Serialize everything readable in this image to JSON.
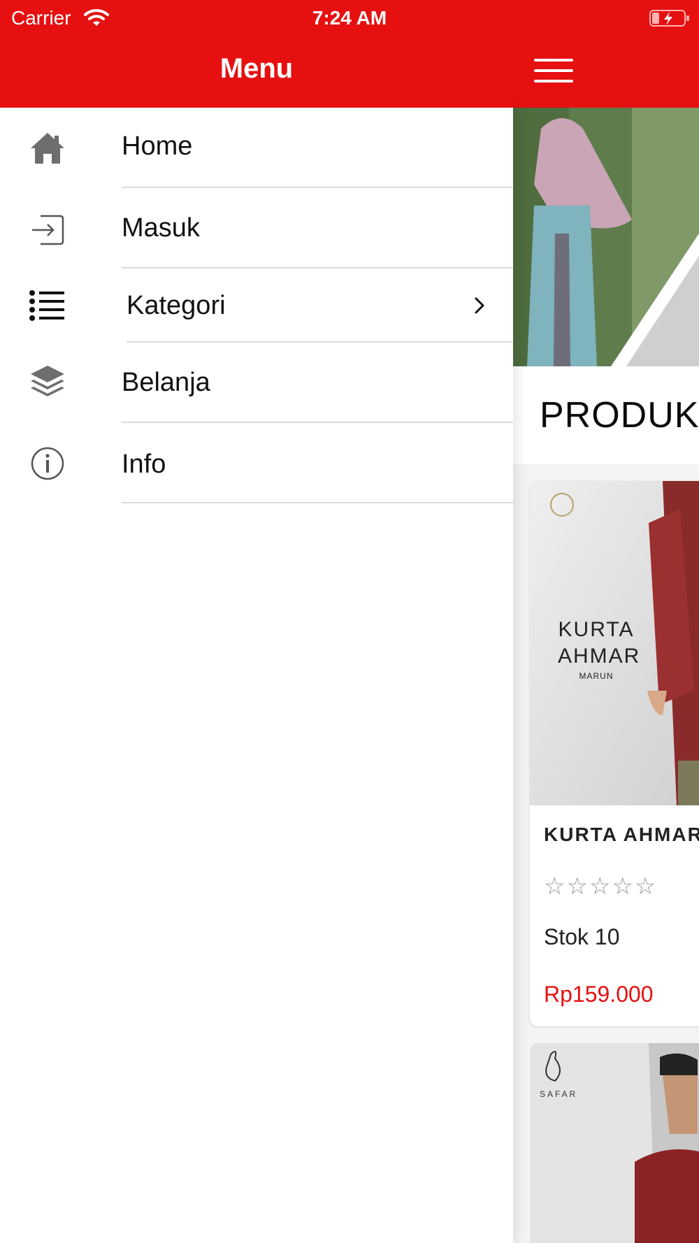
{
  "status_bar": {
    "carrier": "Carrier",
    "time": "7:24 AM"
  },
  "menu": {
    "title": "Menu",
    "items": [
      {
        "label": "Home",
        "icon": "home-icon"
      },
      {
        "label": "Masuk",
        "icon": "login-icon"
      },
      {
        "label": "Kategori",
        "icon": "list-icon",
        "has_chevron": true
      },
      {
        "label": "Belanja",
        "icon": "layers-icon"
      },
      {
        "label": "Info",
        "icon": "info-icon"
      }
    ]
  },
  "main": {
    "section_title": "PRODUK",
    "products": [
      {
        "image_text_line1": "KURTA",
        "image_text_line2": "AHMAR",
        "image_text_sub": "MARUN",
        "name": "KURTA AHMAR",
        "rating_stars": "☆☆☆☆☆",
        "stock": "Stok 10",
        "price": "Rp159.000"
      },
      {
        "image_logo_text": "SAFAR"
      }
    ]
  },
  "colors": {
    "brand_red": "#e61010",
    "price_red": "#e61010",
    "separator": "#dcdcdc"
  }
}
